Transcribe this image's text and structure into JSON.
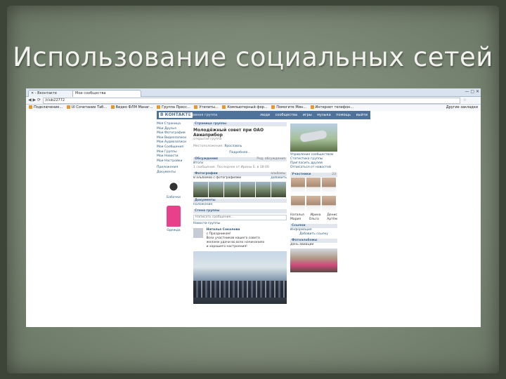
{
  "slide": {
    "title": "Использование социальных сетей"
  },
  "browser": {
    "tabs": [
      {
        "label": "✕ - Вконтакте",
        "active": false
      },
      {
        "label": "Мои сообщества",
        "active": true
      }
    ],
    "window_controls": "— ▢ ✕",
    "nav_glyphs": "◀ ▶ ⟳",
    "url": "/club22772",
    "bookmarks": [
      "Подключение...",
      "Ul Сочетание Таб...",
      "Видео ФЛМ Манаг...",
      "Группа Пресс...",
      "Утилиты...",
      "Компьютерный фор...",
      "Помогите Мин...",
      "Интернет телефон..."
    ],
    "bookmarks_right": "Другие закладки"
  },
  "vk": {
    "logo": "В КОНТАКТЕ",
    "home": "« Главная группа",
    "menu": [
      "люди",
      "сообщества",
      "игры",
      "музыка",
      "помощь",
      "выйти"
    ],
    "left_nav": [
      "Моя Страница",
      "Мои Друзья",
      "Мои Фотографии",
      "Мои Видеозаписи",
      "Мои Аудиозаписи",
      "Мои Сообщения",
      "Мои Группы",
      "Мои Новости",
      "Мои Настройки",
      "Приложения",
      "Документы"
    ],
    "breadcrumb": "Страница группы",
    "group_title": "Молодёжный совет при ОАО Авиаприбор",
    "group_subtitle": "открытая группа",
    "status_label": "Местоположение:",
    "status_value": "Ярославль",
    "more_info": "Подробнее...",
    "discussions_header": "Обсуждения",
    "discussions_right": "Ред. обсуждения",
    "discussion_topic": "Итоги",
    "discussion_meta": "1 сообщение. Последнее от Ирины Б. в 18:00",
    "photos_header": "Фотографии",
    "photos_right": "альбомы",
    "photos_meta": "8 альбомов с фотографиями",
    "photos_add": "Добавить",
    "docs_header": "Документы",
    "docs_item": "Положение",
    "wall_header": "Стена группы",
    "wall_placeholder": "Написать сообщение...",
    "wall_tab": "Новости группы",
    "post_author": "Наталья Соколова",
    "post_lines": [
      "с Праздником!",
      "Всех участников нашего совета",
      "желаем удачи во всех начинаниях",
      "и хорошего настроения!"
    ],
    "right_links": [
      "Управление сообществом",
      "Статистика группы",
      "Пригласить друзей",
      "Отписаться от новостей"
    ],
    "members_header": "Участники",
    "members_count": "23",
    "members": [
      "Наталья",
      "Ирина",
      "Денис",
      "Мария",
      "Ольга",
      "Артём"
    ],
    "links_header": "Ссылки",
    "links_items": [
      "Информация",
      "Добавить ссылку"
    ],
    "album_header": "Фотоальбомы",
    "album_caption": "День авиации",
    "adv_items": [
      "Бабочки",
      "Одежда"
    ]
  }
}
